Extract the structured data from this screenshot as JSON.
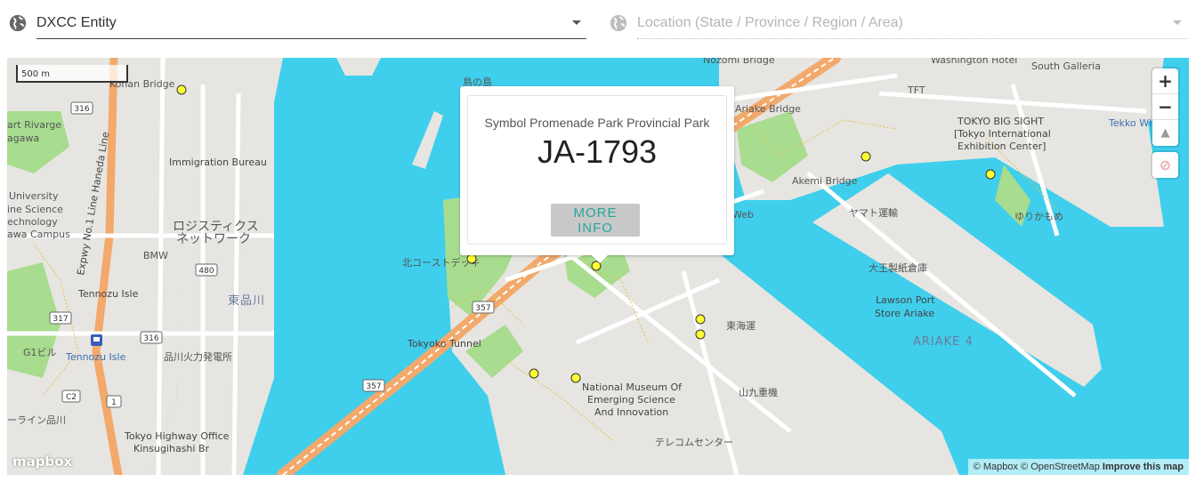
{
  "filters": {
    "dxcc": {
      "value": "DXCC Entity",
      "icon": "globe-icon"
    },
    "location": {
      "placeholder": "Location (State / Province / Region / Area)",
      "icon": "globe-icon"
    }
  },
  "map": {
    "scale_label": "500 m",
    "controls": {
      "zoom_in": "+",
      "zoom_out": "−",
      "compass": "▲",
      "disable": "⊘"
    },
    "popup": {
      "park_name": "Symbol Promenade Park Provincial Park",
      "reference": "JA-1793",
      "button": "MORE INFO"
    },
    "labels": {
      "nozomi_bridge": "Nozomi Bridge",
      "washington_hotel": "Washington Hotel",
      "south_galleria": "South Galleria",
      "konan_bridge": "Konan Bridge",
      "tori_no_shima": "鳥の島",
      "tft": "TFT",
      "ariake_bridge": "Ariake Bridge",
      "big_sight_1": "TOKYO BIG SIGHT",
      "big_sight_2": "[Tokyo International",
      "big_sight_3": "Exhibition Center]",
      "tekko": "Tekko Wh",
      "art_rivarge": "art Rivarge",
      "gawa": "agawa",
      "immigration": "Immigration Bureau",
      "akemi_bridge": "Akemi Bridge",
      "yurikamome": "ゆりかもめ",
      "university_1": "University",
      "university_2": "ine Science",
      "university_3": "echnology",
      "university_4": "awa Campus",
      "logistics_1": "ロジスティクス",
      "logistics_2": "ネットワーク",
      "web": "Web",
      "yamato": "ヤマト運輸",
      "bmw": "BMW",
      "kita_coast": "北コーストデッキ",
      "oji": "大王製紙倉庫",
      "tennozu_isle_1": "Tennozu Isle",
      "higashi_shinagawa": "東品川",
      "lawson_1": "Lawson Port",
      "lawson_2": "Store Ariake",
      "higashi_kaiun": "東海運",
      "ariake4": "ARIAKE 4",
      "g1": "G1ビル",
      "tennozu_isle_2": "Tennozu Isle",
      "tokyoko_tunnel": "Tokyoko Tunnel",
      "shinagawa_power": "品川火力発電所",
      "museum_1": "National Museum Of",
      "museum_2": "Emerging Science",
      "museum_3": "And Innovation",
      "sankyu": "山九重機",
      "line_shinagawa": "ーライン品川",
      "hwy_office_1": "Tokyo Highway Office",
      "hwy_office_2": "Kinsugihashi Br",
      "telecom": "テレコムセンター",
      "expwy": "Expwy No.1 Line Haneda Line",
      "shield_316": "316",
      "shield_480": "480",
      "shield_317": "317",
      "shield_316b": "316",
      "shield_357a": "357",
      "shield_357b": "357",
      "shield_c2": "C2",
      "shield_1": "1"
    },
    "markers": 12,
    "logo": "mapbox",
    "attribution": {
      "mapbox": "© Mapbox",
      "osm": "© OpenStreetMap",
      "improve": "Improve this map"
    }
  },
  "colors": {
    "water": "#3fcfec",
    "land": "#e7e5e1",
    "park": "#a8dc8f",
    "road": "#ffffff",
    "highway": "#f2a96b",
    "marker": "#ffff33",
    "accent": "#26a69a"
  }
}
